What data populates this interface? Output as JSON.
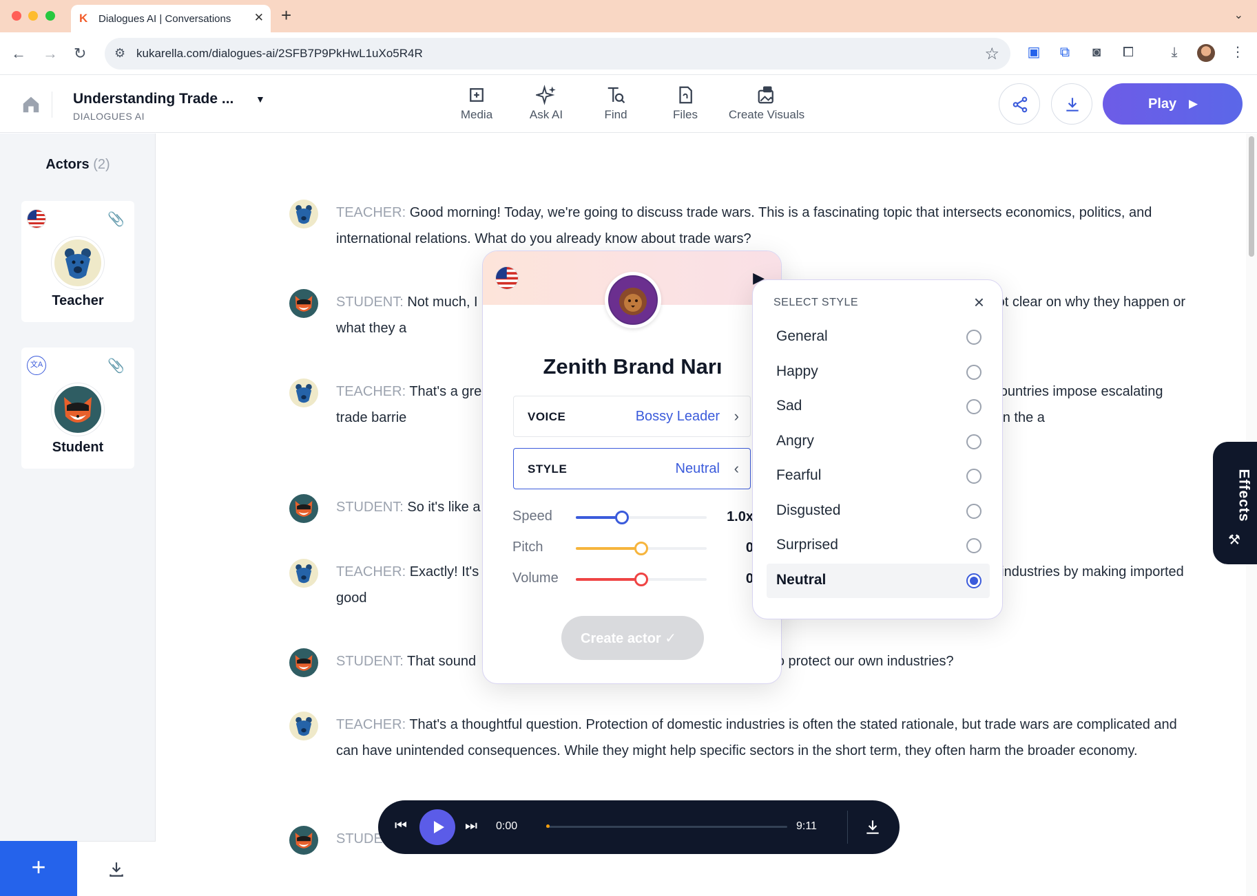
{
  "browser": {
    "tab_title": "Dialogues AI | Conversations",
    "url": "kukarella.com/dialogues-ai/2SFB7P9PkHwL1uXo5R4R"
  },
  "header": {
    "doc_title": "Understanding Trade ...",
    "doc_subtitle": "DIALOGUES AI",
    "tools": [
      {
        "label": "Media",
        "icon": "media-icon"
      },
      {
        "label": "Ask AI",
        "icon": "sparkle-icon"
      },
      {
        "label": "Find",
        "icon": "find-icon"
      },
      {
        "label": "Files",
        "icon": "files-icon"
      },
      {
        "label": "Create Visuals",
        "icon": "create-visuals-icon"
      }
    ],
    "play_label": "Play"
  },
  "sidebar": {
    "actors_label": "Actors",
    "actors_count": "(2)",
    "actors": [
      {
        "name": "Teacher"
      },
      {
        "name": "Student"
      }
    ]
  },
  "transcript": [
    {
      "speaker": "TEACHER:",
      "text": "Good morning! Today, we're going to discuss trade wars. This is a fascinating topic that intersects economics, politics, and international relations. What do you already know about trade wars?"
    },
    {
      "speaker": "STUDENT:",
      "text": "Not much, I                                                                                                                              t I'm not clear on why they happen or what they a"
    },
    {
      "speaker": "TEACHER:",
      "text": "That's a gre                                                                                                                      urs when countries impose escalating trade barrie                                                                                           on imports from another country, and then the a"
    },
    {
      "speaker": "STUDENT:",
      "text": "So it's like a"
    },
    {
      "speaker": "TEACHER:",
      "text": "Exactly! It's                                                                                                                           omestic industries by making imported good                                                                                                  ods instead."
    },
    {
      "speaker": "STUDENT:",
      "text": "That sound                                                                  e want to protect our own industries?"
    },
    {
      "speaker": "TEACHER:",
      "text": "That's a thoughtful question. Protection of domestic industries is often the stated rationale, but trade wars are complicated and can have unintended consequences. While they might help specific sectors in the short term, they often harm the broader economy."
    },
    {
      "speaker": "STUDE",
      "text": ""
    }
  ],
  "effects_label": "Effects",
  "actor_popover": {
    "name": "Zenith Brand Narı",
    "voice_label": "VOICE",
    "voice_value": "Bossy Leader",
    "style_label": "STYLE",
    "style_value": "Neutral",
    "sliders": [
      {
        "label": "Speed",
        "value_text": "1.0x",
        "level": 0.35,
        "color": "#3b5bdb"
      },
      {
        "label": "Pitch",
        "value_text": "0",
        "level": 0.5,
        "color": "#f6b53d"
      },
      {
        "label": "Volume",
        "value_text": "0",
        "level": 0.5,
        "color": "#ef4444"
      }
    ],
    "create_label": "Create actor ✓"
  },
  "style_popover": {
    "title": "SELECT STYLE",
    "options": [
      "General",
      "Happy",
      "Sad",
      "Angry",
      "Fearful",
      "Disgusted",
      "Surprised",
      "Neutral"
    ],
    "selected": "Neutral"
  },
  "player": {
    "current_time": "0:00",
    "duration": "9:11",
    "progress": 0.0
  }
}
